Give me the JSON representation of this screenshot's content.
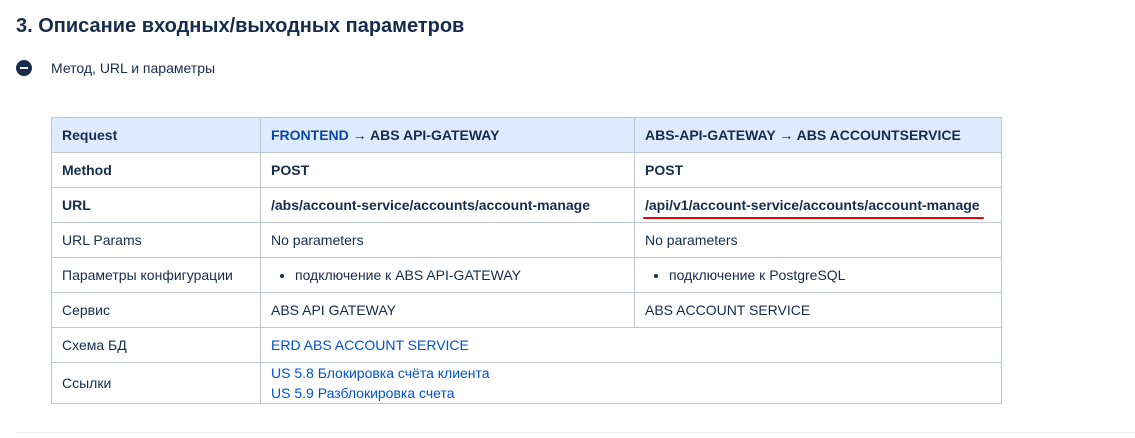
{
  "heading": "3. Описание входных/выходных параметров",
  "expand_label": "Метод, URL и параметры",
  "table": {
    "header": {
      "col1": "Request",
      "col2_prefix": "FRONTEND",
      "col2_suffix": " → ABS API-GATEWAY",
      "col3": "ABS-API-GATEWAY → ABS ACCOUNTSERVICE"
    },
    "rows": {
      "method": {
        "label": "Method",
        "v1": "POST",
        "v2": "POST"
      },
      "url": {
        "label": "URL",
        "v1": "/abs/account-service/accounts/account-manage",
        "v2": "/api/v1/account-service/accounts/account-manage"
      },
      "url_params": {
        "label": "URL Params",
        "v1": "No parameters",
        "v2": "No parameters"
      },
      "config": {
        "label": "Параметры конфигурации",
        "v1": "подключение к ABS  API-GATEWAY",
        "v2": "подключение к PostgreSQL"
      },
      "service": {
        "label": "Сервис",
        "v1": "ABS API GATEWAY",
        "v2": "ABS ACCOUNT SERVICE"
      },
      "db_schema": {
        "label": "Схема БД",
        "link": "ERD ABS ACCOUNT SERVICE"
      },
      "links": {
        "label": "Ссылки",
        "link1": "US 5.8 Блокировка счёта клиента",
        "link2": "US 5.9 Разблокировка счета"
      }
    }
  },
  "colors": {
    "header_bg": "#deebff",
    "border": "#c1c7d0",
    "link": "#0052cc",
    "text": "#172b4d",
    "highlight_underline": "#e5000c"
  },
  "icons": {
    "expand": "collapse-circle-icon"
  }
}
